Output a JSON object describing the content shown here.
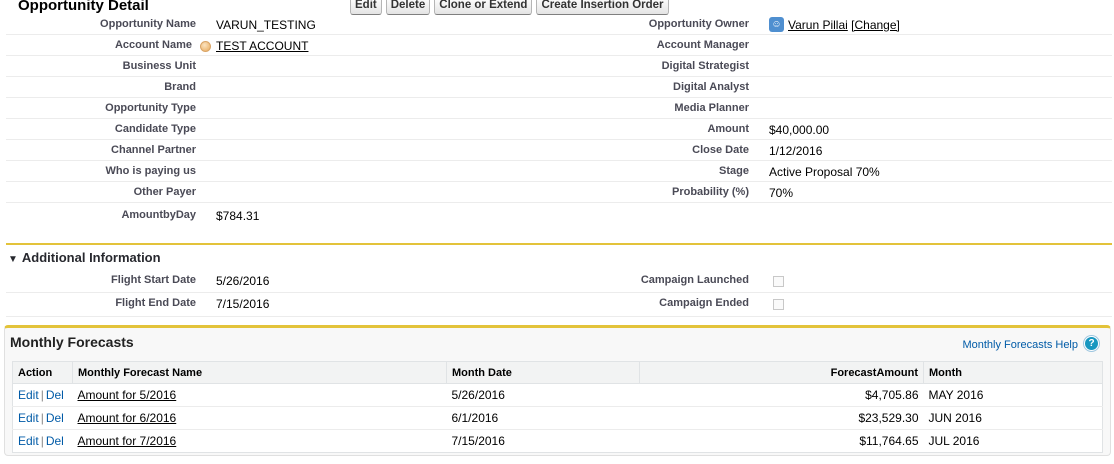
{
  "header": {
    "title": "Opportunity Detail",
    "buttons": {
      "edit": "Edit",
      "delete": "Delete",
      "clone": "Clone or Extend",
      "create_io": "Create Insertion Order"
    }
  },
  "detail": {
    "opportunity_name": {
      "label": "Opportunity Name",
      "value": "VARUN_TESTING"
    },
    "opportunity_owner": {
      "label": "Opportunity Owner",
      "value": "Varun Pillai",
      "change": "[Change]"
    },
    "account_name": {
      "label": "Account Name",
      "value": "TEST ACCOUNT"
    },
    "account_manager": {
      "label": "Account Manager",
      "value": ""
    },
    "business_unit": {
      "label": "Business Unit",
      "value": ""
    },
    "digital_strategist": {
      "label": "Digital Strategist",
      "value": ""
    },
    "brand": {
      "label": "Brand",
      "value": ""
    },
    "digital_analyst": {
      "label": "Digital Analyst",
      "value": ""
    },
    "opportunity_type": {
      "label": "Opportunity Type",
      "value": ""
    },
    "media_planner": {
      "label": "Media Planner",
      "value": ""
    },
    "candidate_type": {
      "label": "Candidate Type",
      "value": ""
    },
    "amount": {
      "label": "Amount",
      "value": "$40,000.00"
    },
    "channel_partner": {
      "label": "Channel Partner",
      "value": ""
    },
    "close_date": {
      "label": "Close Date",
      "value": "1/12/2016"
    },
    "who_is_paying": {
      "label": "Who is paying us",
      "value": ""
    },
    "stage": {
      "label": "Stage",
      "value": "Active Proposal 70%"
    },
    "other_payer": {
      "label": "Other Payer",
      "value": ""
    },
    "probability": {
      "label": "Probability (%)",
      "value": "70%"
    },
    "amount_by_day": {
      "label": "AmountbyDay",
      "value": "$784.31"
    }
  },
  "additional": {
    "title": "Additional Information",
    "flight_start": {
      "label": "Flight Start Date",
      "value": "5/26/2016"
    },
    "campaign_launched": {
      "label": "Campaign Launched",
      "checked": false
    },
    "flight_end": {
      "label": "Flight End Date",
      "value": "7/15/2016"
    },
    "campaign_ended": {
      "label": "Campaign Ended",
      "checked": false
    }
  },
  "forecasts": {
    "title": "Monthly Forecasts",
    "help": "Monthly Forecasts Help",
    "columns": [
      "Action",
      "Monthly Forecast Name",
      "Month Date",
      "ForecastAmount",
      "Month"
    ],
    "edit_label": "Edit",
    "del_label": "Del",
    "rows": [
      {
        "name": "Amount for 5/2016",
        "date": "5/26/2016",
        "amount": "$4,705.86",
        "month": "MAY 2016"
      },
      {
        "name": "Amount for 6/2016",
        "date": "6/1/2016",
        "amount": "$23,529.30",
        "month": "JUN 2016"
      },
      {
        "name": "Amount for 7/2016",
        "date": "7/15/2016",
        "amount": "$11,764.65",
        "month": "JUL 2016"
      }
    ]
  },
  "colors": {
    "accent_gold": "#e3c33a",
    "link_blue": "#015ba7",
    "label_gray": "#4a4a56"
  }
}
